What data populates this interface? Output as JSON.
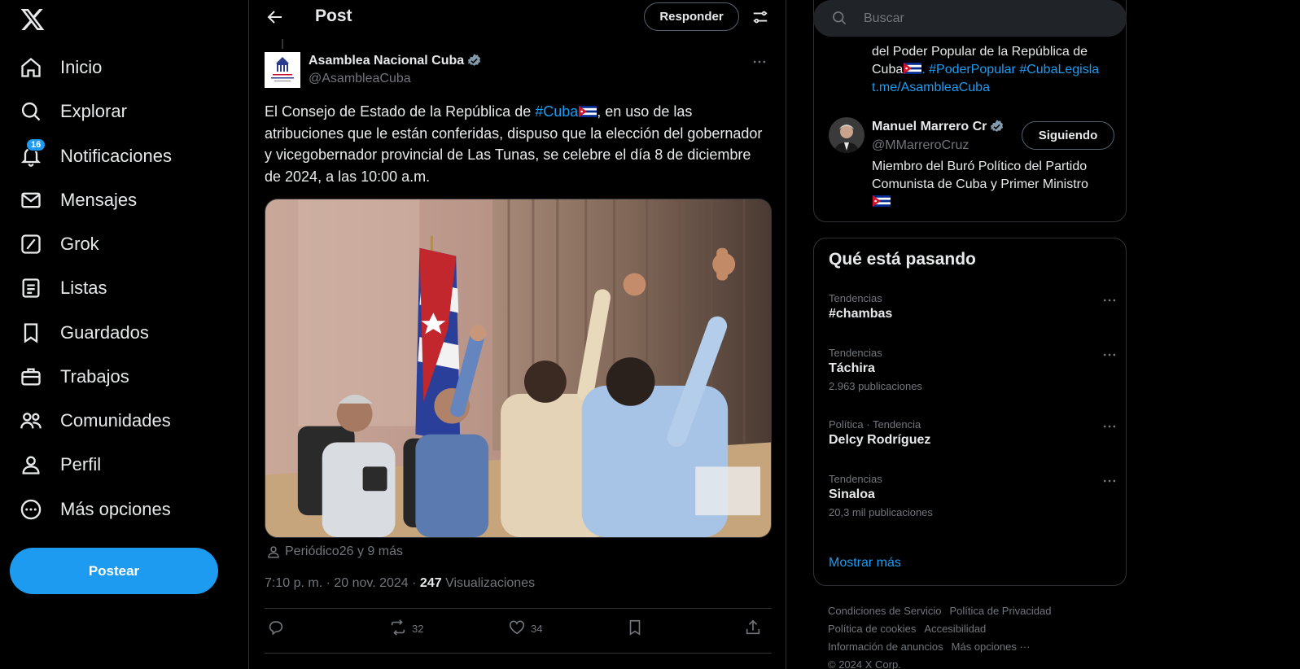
{
  "nav": {
    "items": [
      {
        "label": "Inicio",
        "icon": "home-icon"
      },
      {
        "label": "Explorar",
        "icon": "search-icon"
      },
      {
        "label": "Notificaciones",
        "icon": "bell-icon",
        "badge": "16"
      },
      {
        "label": "Mensajes",
        "icon": "mail-icon"
      },
      {
        "label": "Grok",
        "icon": "grok-icon"
      },
      {
        "label": "Listas",
        "icon": "list-icon"
      },
      {
        "label": "Guardados",
        "icon": "bookmark-icon"
      },
      {
        "label": "Trabajos",
        "icon": "briefcase-icon"
      },
      {
        "label": "Comunidades",
        "icon": "people-icon"
      },
      {
        "label": "Perfil",
        "icon": "person-icon"
      },
      {
        "label": "Más opciones",
        "icon": "more-circle-icon"
      }
    ],
    "post_button": "Postear"
  },
  "header": {
    "title": "Post",
    "reply_button": "Responder"
  },
  "post": {
    "author_name": "Asamblea Nacional Cuba",
    "author_handle": "@AsambleaCuba",
    "text_before": "El Consejo de Estado de la República de ",
    "hashtag": "#Cuba",
    "text_after": ", en uso de las atribuciones que le están conferidas, dispuso que la elección del gobernador y vicegobernador provincial de Las Tunas, se celebre el día 8 de diciembre de 2024, a las 10:00 a.m.",
    "tagged": "Periódico26 y 9 más",
    "time": "7:10 p. m. · 20 nov. 2024 · ",
    "views_count": "247",
    "views_label": "Visualizaciones",
    "reposts": "32",
    "likes": "34"
  },
  "right": {
    "search_placeholder": "Buscar",
    "who": {
      "prev_text": "del Poder Popular de la República de Cuba",
      "prev_tags": ". #PoderPopular #CubaLegisla",
      "prev_link": "t.me/AsambleaCuba",
      "name": "Manuel Marrero Cr",
      "handle": "@MMarreroCruz",
      "follow_button": "Siguiendo",
      "bio": "Miembro del Buró Político del Partido Comunista de Cuba y Primer Ministro"
    },
    "trends": {
      "title": "Qué está pasando",
      "items": [
        {
          "context": "Tendencias",
          "name": "#chambas",
          "count": ""
        },
        {
          "context": "Tendencias",
          "name": "Táchira",
          "count": "2.963 publicaciones"
        },
        {
          "context": "Política · Tendencia",
          "name": "Delcy Rodríguez",
          "count": ""
        },
        {
          "context": "Tendencias",
          "name": "Sinaloa",
          "count": "20,3 mil publicaciones"
        }
      ],
      "show_more": "Mostrar más"
    },
    "footer": {
      "terms": "Condiciones de Servicio",
      "privacy": "Política de Privacidad",
      "cookies": "Política de cookies",
      "accessibility": "Accesibilidad",
      "ads": "Información de anuncios",
      "more": "Más opciones ···",
      "copyright": "© 2024 X Corp."
    }
  }
}
